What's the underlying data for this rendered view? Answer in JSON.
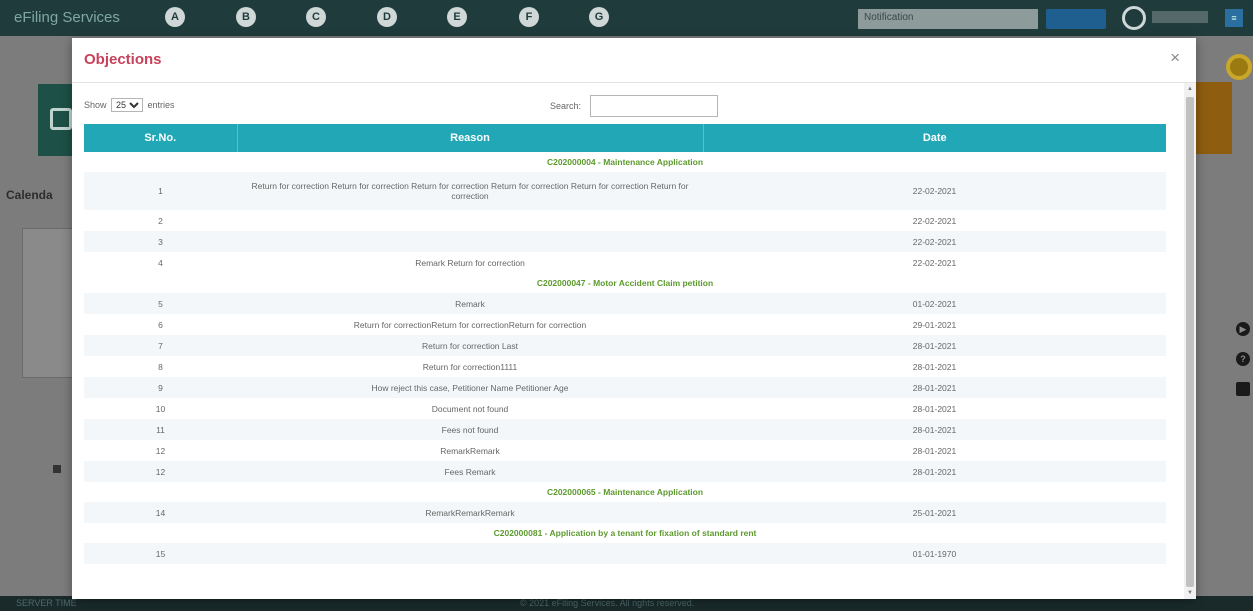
{
  "background": {
    "brand": "eFiling Services",
    "top_icons": [
      "A",
      "B",
      "C",
      "D",
      "E",
      "F",
      "G"
    ],
    "select_value": "Notification",
    "cal_label": "Calenda",
    "footer_left": "SERVER TIME",
    "footer_mid": "© 2021 eFiling Services. All rights reserved.",
    "side_icons": [
      "play-circle-icon",
      "help-circle-icon",
      "document-icon"
    ]
  },
  "modal": {
    "title": "Objections",
    "close_label": "×",
    "length_menu": {
      "prefix": "Show",
      "selected": "25",
      "suffix": "entries"
    },
    "search_label": "Search:",
    "search_value": "",
    "columns": [
      "Sr.No.",
      "Reason",
      "Date"
    ],
    "rows": [
      {
        "type": "group",
        "label": "C202000004 - Maintenance Application"
      },
      {
        "type": "row",
        "sr": "1",
        "reason": "Return for correction Return for correction Return for correction Return for correction Return for correction Return for correction",
        "date": "22-02-2021"
      },
      {
        "type": "row",
        "sr": "2",
        "reason": "",
        "date": "22-02-2021"
      },
      {
        "type": "row",
        "sr": "3",
        "reason": "",
        "date": "22-02-2021"
      },
      {
        "type": "row",
        "sr": "4",
        "reason": "Remark Return for correction",
        "date": "22-02-2021"
      },
      {
        "type": "group",
        "label": "C202000047 - Motor Accident Claim petition"
      },
      {
        "type": "row",
        "sr": "5",
        "reason": "Remark",
        "date": "01-02-2021"
      },
      {
        "type": "row",
        "sr": "6",
        "reason": "Return for correctionReturn for correctionReturn for correction",
        "date": "29-01-2021"
      },
      {
        "type": "row",
        "sr": "7",
        "reason": "Return for correction Last",
        "date": "28-01-2021"
      },
      {
        "type": "row",
        "sr": "8",
        "reason": "Return for correction1111",
        "date": "28-01-2021"
      },
      {
        "type": "row",
        "sr": "9",
        "reason": "How reject this case, Petitioner Name Petitioner Age",
        "date": "28-01-2021"
      },
      {
        "type": "row",
        "sr": "10",
        "reason": "Document not found",
        "date": "28-01-2021"
      },
      {
        "type": "row",
        "sr": "11",
        "reason": "Fees not found",
        "date": "28-01-2021"
      },
      {
        "type": "row",
        "sr": "12",
        "reason": "RemarkRemark",
        "date": "28-01-2021"
      },
      {
        "type": "row",
        "sr": "12",
        "reason": "Fees Remark",
        "date": "28-01-2021"
      },
      {
        "type": "group",
        "label": "C202000065 - Maintenance Application"
      },
      {
        "type": "row",
        "sr": "14",
        "reason": "RemarkRemarkRemark",
        "date": "25-01-2021"
      },
      {
        "type": "group",
        "label": "C202000081 - Application by a tenant for fixation of standard rent"
      },
      {
        "type": "row",
        "sr": "15",
        "reason": "",
        "date": "01-01-1970"
      }
    ]
  }
}
